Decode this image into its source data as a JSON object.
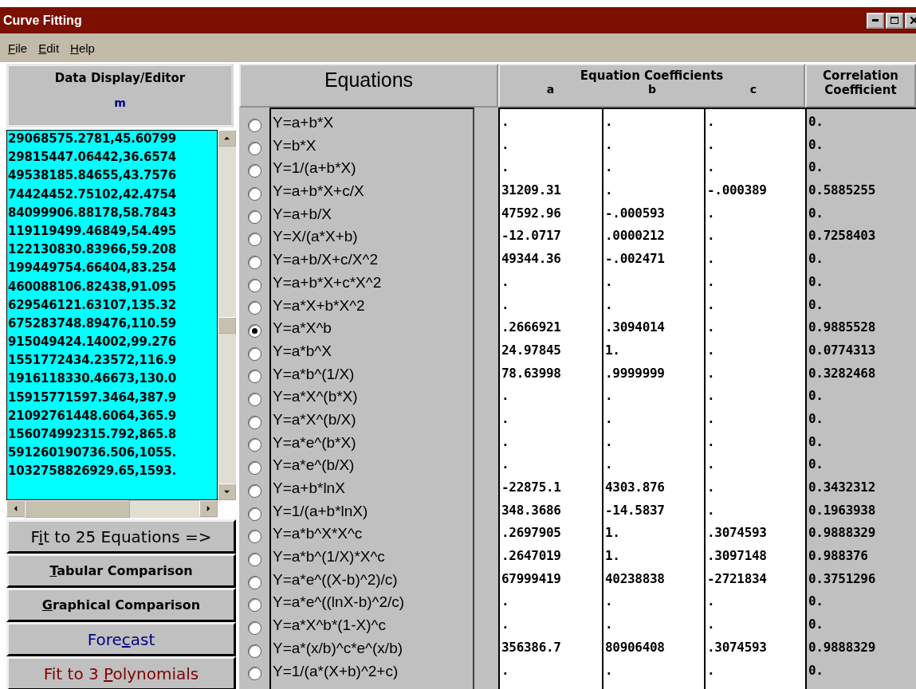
{
  "window": {
    "title": "Curve Fitting"
  },
  "menu": [
    {
      "label": {
        "key": "F",
        "after": "ile"
      }
    },
    {
      "label": {
        "key": "E",
        "after": "dit"
      }
    },
    {
      "label": {
        "key": "H",
        "after": "elp"
      }
    }
  ],
  "data_panel": {
    "title": "Data Display/Editor",
    "column": "m",
    "rows": [
      "29068575.2781,45.60799",
      "29815447.06442,36.6574",
      "49538185.84655,43.7576",
      "74424452.75102,42.4754",
      "84099906.88178,58.7843",
      "119119499.46849,54.495",
      "122130830.83966,59.208",
      "199449754.66404,83.254",
      "460088106.82438,91.095",
      "629546121.63107,135.32",
      "675283748.89476,110.59",
      "915049424.14002,99.276",
      "1551772434.23572,116.9",
      "1916118330.46673,130.0",
      "15915771597.3464,387.9",
      "21092761448.6064,365.9",
      "156074992315.792,865.8",
      "591260190736.506,1055.",
      "1032758826929.65,1593."
    ]
  },
  "buttons": [
    {
      "kind": "primary",
      "label": {
        "before": "F",
        "key": "i",
        "after": "t to 25 Equations =>"
      }
    },
    {
      "kind": "plain",
      "label": {
        "key": "T",
        "after": "abular Comparison"
      }
    },
    {
      "kind": "plain",
      "label": {
        "key": "G",
        "after": "raphical Comparison"
      }
    },
    {
      "kind": "blue",
      "label": {
        "before": "Fore",
        "key": "c",
        "after": "ast"
      }
    },
    {
      "kind": "red",
      "label": {
        "before": "Fit to 3 ",
        "key": "P",
        "after": "olynomials"
      }
    }
  ],
  "equations": {
    "title": "Equations",
    "coefficients_title": "Equation Coefficients",
    "columns": [
      "a",
      "b",
      "c"
    ],
    "correlation_title": "Correlation Coefficient",
    "rows": [
      {
        "equation": "Y=a+b*X",
        "selected": false,
        "a": ".",
        "b": ".",
        "c": ".",
        "r": "0."
      },
      {
        "equation": "Y=b*X",
        "selected": false,
        "a": ".",
        "b": ".",
        "c": ".",
        "r": "0."
      },
      {
        "equation": "Y=1/(a+b*X)",
        "selected": false,
        "a": ".",
        "b": ".",
        "c": ".",
        "r": "0."
      },
      {
        "equation": "Y=a+b*X+c/X",
        "selected": false,
        "a": "31209.31",
        "b": ".",
        "c": "-.000389",
        "r": "0.5885255"
      },
      {
        "equation": "Y=a+b/X",
        "selected": false,
        "a": "47592.96",
        "b": "-.000593",
        "c": ".",
        "r": "0."
      },
      {
        "equation": "Y=X/(a*X+b)",
        "selected": false,
        "a": "-12.0717",
        "b": ".0000212",
        "c": ".",
        "r": "0.7258403"
      },
      {
        "equation": "Y=a+b/X+c/X^2",
        "selected": false,
        "a": "49344.36",
        "b": "-.002471",
        "c": ".",
        "r": "0."
      },
      {
        "equation": "Y=a+b*X+c*X^2",
        "selected": false,
        "a": ".",
        "b": ".",
        "c": ".",
        "r": "0."
      },
      {
        "equation": "Y=a*X+b*X^2",
        "selected": false,
        "a": ".",
        "b": ".",
        "c": ".",
        "r": "0."
      },
      {
        "equation": "Y=a*X^b",
        "selected": true,
        "a": ".2666921",
        "b": ".3094014",
        "c": ".",
        "r": "0.9885528"
      },
      {
        "equation": "Y=a*b^X",
        "selected": false,
        "a": "24.97845",
        "b": "1.",
        "c": ".",
        "r": "0.0774313"
      },
      {
        "equation": "Y=a*b^(1/X)",
        "selected": false,
        "a": "78.63998",
        "b": ".9999999",
        "c": ".",
        "r": "0.3282468"
      },
      {
        "equation": "Y=a*X^(b*X)",
        "selected": false,
        "a": ".",
        "b": ".",
        "c": ".",
        "r": "0."
      },
      {
        "equation": "Y=a*X^(b/X)",
        "selected": false,
        "a": ".",
        "b": ".",
        "c": ".",
        "r": "0."
      },
      {
        "equation": "Y=a*e^(b*X)",
        "selected": false,
        "a": ".",
        "b": ".",
        "c": ".",
        "r": "0."
      },
      {
        "equation": "Y=a*e^(b/X)",
        "selected": false,
        "a": ".",
        "b": ".",
        "c": ".",
        "r": "0."
      },
      {
        "equation": "Y=a+b*lnX",
        "selected": false,
        "a": "-22875.1",
        "b": "4303.876",
        "c": ".",
        "r": "0.3432312"
      },
      {
        "equation": "Y=1/(a+b*lnX)",
        "selected": false,
        "a": "348.3686",
        "b": "-14.5837",
        "c": ".",
        "r": "0.1963938"
      },
      {
        "equation": "Y=a*b^X*X^c",
        "selected": false,
        "a": ".2697905",
        "b": "1.",
        "c": ".3074593",
        "r": "0.9888329"
      },
      {
        "equation": "Y=a*b^(1/X)*X^c",
        "selected": false,
        "a": ".2647019",
        "b": "1.",
        "c": ".3097148",
        "r": "0.988376"
      },
      {
        "equation": "Y=a*e^((X-b)^2)/c)",
        "selected": false,
        "a": "67999419",
        "b": "40238838",
        "c": "-2721834",
        "r": "0.3751296"
      },
      {
        "equation": "Y=a*e^((lnX-b)^2/c)",
        "selected": false,
        "a": ".",
        "b": ".",
        "c": ".",
        "r": "0."
      },
      {
        "equation": "Y=a*X^b*(1-X)^c",
        "selected": false,
        "a": ".",
        "b": ".",
        "c": ".",
        "r": "0."
      },
      {
        "equation": "Y=a*(x/b)^c*e^(x/b)",
        "selected": false,
        "a": "356386.7",
        "b": "80906408",
        "c": ".3074593",
        "r": "0.9888329"
      },
      {
        "equation": "Y=1/(a*(X+b)^2+c)",
        "selected": false,
        "a": ".",
        "b": ".",
        "c": ".",
        "r": "0."
      }
    ]
  }
}
